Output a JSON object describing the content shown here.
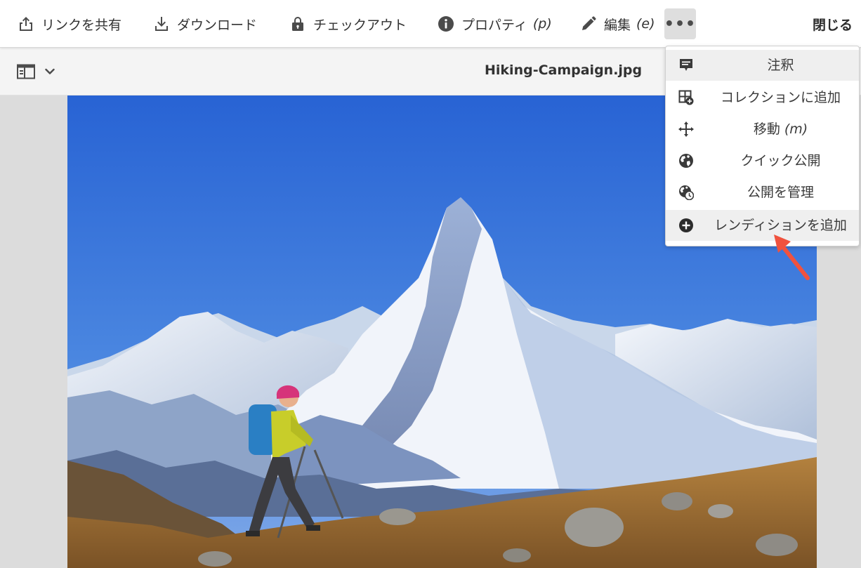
{
  "toolbar": {
    "share_link": {
      "label": "リンクを共有",
      "icon": "share-icon"
    },
    "download": {
      "label": "ダウンロード",
      "icon": "download-icon"
    },
    "checkout": {
      "label": "チェックアウト",
      "icon": "lock-icon"
    },
    "properties": {
      "label": "プロパティ",
      "shortcut": "(p)",
      "icon": "info-icon"
    },
    "edit": {
      "label": "編集",
      "shortcut": "(e)",
      "icon": "pencil-icon"
    },
    "more": {
      "label": "•••",
      "icon": "more-icon"
    },
    "close": {
      "label": "閉じる"
    }
  },
  "subheader": {
    "rail_toggle_icon": "rail-toggle-icon",
    "title": "Hiking-Campaign.jpg"
  },
  "menu": {
    "items": [
      {
        "label": "注釈",
        "shortcut": "",
        "icon": "annotate-icon",
        "highlighted": true
      },
      {
        "label": "コレクションに追加",
        "shortcut": "",
        "icon": "collection-add-icon",
        "highlighted": false
      },
      {
        "label": "移動",
        "shortcut": "(m)",
        "icon": "move-icon",
        "highlighted": false
      },
      {
        "label": "クイック公開",
        "shortcut": "",
        "icon": "globe-icon",
        "highlighted": false
      },
      {
        "label": "公開を管理",
        "shortcut": "",
        "icon": "globe-clock-icon",
        "highlighted": false
      },
      {
        "label": "レンディションを追加",
        "shortcut": "",
        "icon": "add-circle-icon",
        "highlighted": true
      }
    ]
  },
  "colors": {
    "accent_arrow": "#f0523e",
    "toolbar_bg": "#ffffff",
    "subheader_bg": "#f4f4f4",
    "menu_highlight": "#efefef",
    "canvas_bg": "#dcdcdc"
  }
}
